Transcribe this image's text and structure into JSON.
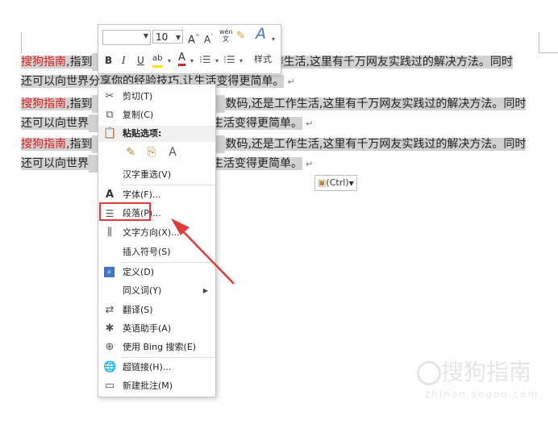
{
  "document": {
    "lines": [
      {
        "prefix": "搜狗指南",
        "text": ",指到",
        "tail": "作生活,这里有千万网友实践过的解决方法。同时"
      },
      {
        "prefix": "",
        "text": "还可以向世界分享你的经验技巧,让生活变得更简单。",
        "tail": "",
        "mark": "↵"
      },
      {
        "prefix": "搜狗指南",
        "text": ",指到",
        "tail": "数码,还是工作生活,这里有千万网友实践过的解决方法。同时"
      },
      {
        "prefix": "",
        "text": "还可以向世界",
        "tail": "生活变得更简单。",
        "mark": "↵"
      },
      {
        "prefix": "搜狗指南",
        "text": ",指到",
        "tail": "数码,还是工作生活,这里有千万网友实践过的解决方法。同时"
      },
      {
        "prefix": "",
        "text": "还可以向世界",
        "tail": "生活变得更简单。",
        "mark": "↵"
      }
    ],
    "paste_tag": "(Ctrl)"
  },
  "mini_toolbar": {
    "font_name": "",
    "font_size": "10",
    "grow_font": "A",
    "shrink_font": "A",
    "phonetic": "wén文",
    "bold": "B",
    "italic": "I",
    "underline": "U",
    "font_color": "A",
    "styles_icon": "A",
    "styles_label": "样式"
  },
  "context_menu": {
    "items": [
      {
        "label": "剪切(T)",
        "icon": "scissors-icon"
      },
      {
        "label": "复制(C)",
        "icon": "copy-icon"
      },
      {
        "label": "粘贴选项:",
        "icon": "paste-icon"
      },
      {
        "label": "汉字重选(V)"
      },
      {
        "label": "字体(F)...",
        "icon": "font-icon"
      },
      {
        "label": "段落(P)...",
        "icon": "paragraph-icon"
      },
      {
        "label": "文字方向(X)...",
        "icon": "text-direction-icon"
      },
      {
        "label": "插入符号(S)"
      },
      {
        "label": "定义(D)",
        "icon": "define-icon"
      },
      {
        "label": "同义词(Y)"
      },
      {
        "label": "翻译(S)",
        "icon": "translate-icon"
      },
      {
        "label": "英语助手(A)",
        "icon": "english-assistant-icon"
      },
      {
        "label": "使用 Bing 搜索(E)",
        "icon": "bing-search-icon"
      },
      {
        "label": "超链接(H)...",
        "icon": "hyperlink-icon"
      },
      {
        "label": "新建批注(M)",
        "icon": "new-comment-icon"
      }
    ]
  },
  "watermark": {
    "brand": "搜狗指南",
    "url": "zhinan.sogou.com"
  },
  "colors": {
    "highlight_red": "#d21f1f",
    "selection_gray": "#d2d2d2",
    "annotation_red": "#e03a3a"
  }
}
